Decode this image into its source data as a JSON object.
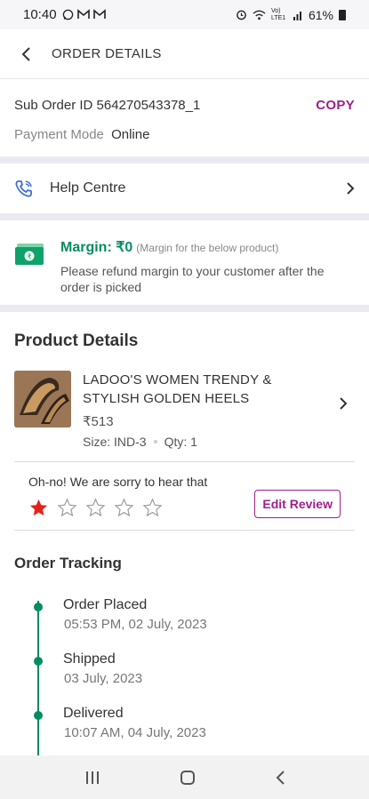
{
  "status_bar": {
    "time": "10:40",
    "battery": "61%",
    "network": "Vo) LTE1"
  },
  "header": {
    "title": "ORDER DETAILS"
  },
  "suborder": {
    "id_text": "Sub Order ID 564270543378_1",
    "copy_label": "COPY",
    "payment_label": "Payment Mode",
    "payment_value": "Online"
  },
  "help": {
    "label": "Help Centre"
  },
  "margin": {
    "title": "Margin: ₹0",
    "subtitle": "(Margin for the below product)",
    "description": "Please refund margin to your customer after the order is picked",
    "colors": {
      "accent": "#038d63"
    }
  },
  "product_details": {
    "title": "Product Details",
    "name": "LADOO'S WOMEN TRENDY & STYLISH GOLDEN HEELS",
    "price": "₹513",
    "size": "Size: IND-3",
    "qty": "Qty: 1"
  },
  "review": {
    "text": "Oh-no! We are sorry to hear that",
    "rating": 1,
    "max_rating": 5,
    "edit_label": "Edit Review",
    "colors": {
      "star_filled": "#e5221a",
      "brand": "#9f2089"
    }
  },
  "tracking": {
    "title": "Order Tracking",
    "steps": [
      {
        "label": "Order Placed",
        "date": "05:53 PM, 02 July, 2023"
      },
      {
        "label": "Shipped",
        "date": "03 July, 2023"
      },
      {
        "label": "Delivered",
        "date": "10:07 AM, 04 July, 2023"
      }
    ]
  },
  "icons": {
    "back": "chevron-left-icon",
    "help": "phone-icon",
    "margin": "cash-icon",
    "chevron": "chevron-right-icon"
  }
}
